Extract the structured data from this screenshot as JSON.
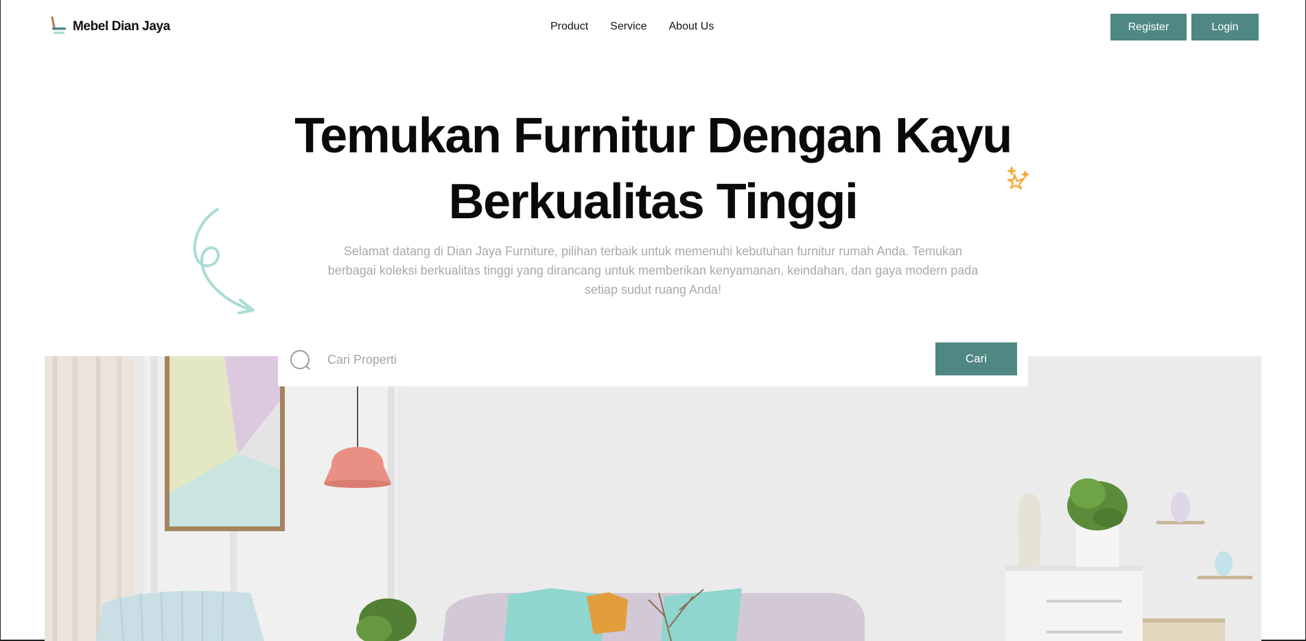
{
  "brand": {
    "name": "Mebel Dian Jaya"
  },
  "nav": {
    "items": [
      {
        "label": "Product"
      },
      {
        "label": "Service"
      },
      {
        "label": "About Us"
      }
    ]
  },
  "auth": {
    "register_label": "Register",
    "login_label": "Login"
  },
  "hero": {
    "title_line1": "Temukan Furnitur Dengan Kayu",
    "title_line2": "Berkualitas Tinggi",
    "subtitle": "Selamat datang di Dian Jaya Furniture, pilihan terbaik untuk memenuhi kebutuhan furnitur rumah Anda. Temukan berbagai koleksi berkualitas tinggi yang dirancang untuk memberikan kenyamanan, keindahan, dan gaya modern pada setiap sudut ruang Anda!"
  },
  "search": {
    "placeholder": "Cari Properti",
    "value": "",
    "button_label": "Cari"
  },
  "icons": {
    "logo": "chair-icon",
    "sparkle": "sparkle-icon",
    "swirl": "curly-arrow-icon",
    "search": "search-icon"
  },
  "colors": {
    "accent": "#4f8783",
    "sparkle": "#f3a83b",
    "swirl": "#a9dcd6",
    "subtitle": "#a9a9a9"
  }
}
